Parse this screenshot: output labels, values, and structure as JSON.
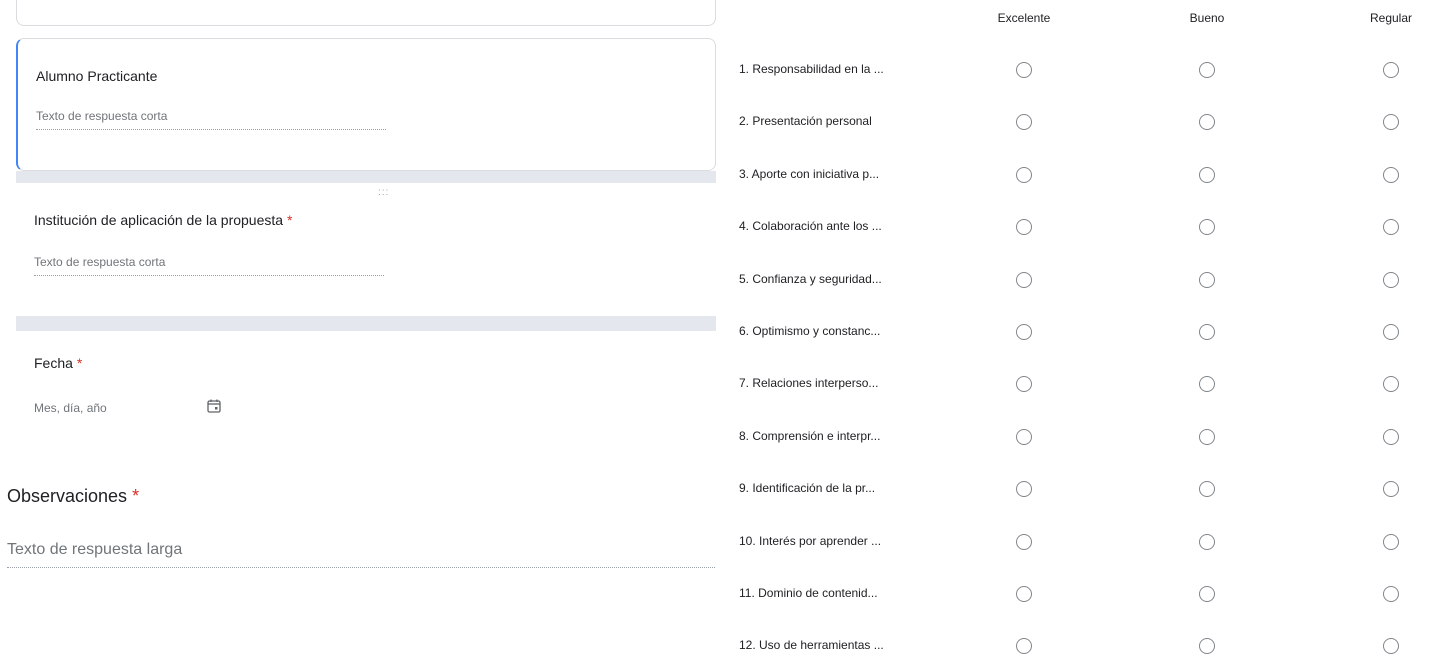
{
  "left": {
    "question_1": {
      "title": "Alumno Practicante",
      "placeholder": "Texto de respuesta corta"
    },
    "question_2": {
      "title": "Institución de aplicación de la propuesta",
      "required_mark": "*",
      "placeholder": "Texto de respuesta corta",
      "drag_handle": ":::"
    },
    "question_3": {
      "title": "Fecha",
      "required_mark": "*",
      "placeholder": "Mes, día, año",
      "icon": "calendar-icon"
    },
    "question_4": {
      "title": "Observaciones",
      "required_mark": "*",
      "placeholder": "Texto de respuesta larga"
    }
  },
  "grid": {
    "columns": [
      "Excelente",
      "Bueno",
      "Regular"
    ],
    "rows": [
      "1. Responsabilidad en la ...",
      "2. Presentación personal",
      "3. Aporte con iniciativa p...",
      "4. Colaboración ante los ...",
      "5. Confianza y seguridad...",
      "6. Optimismo y constanc...",
      "7. Relaciones interperso...",
      "8. Comprensión e interpr...",
      "9. Identificación de la pr...",
      "10. Interés por aprender ...",
      "11. Dominio de contenid...",
      "12. Uso de herramientas ..."
    ]
  },
  "colors": {
    "accent_border": "#4285f4",
    "required": "#d93025",
    "band": "#e5e7ef"
  }
}
